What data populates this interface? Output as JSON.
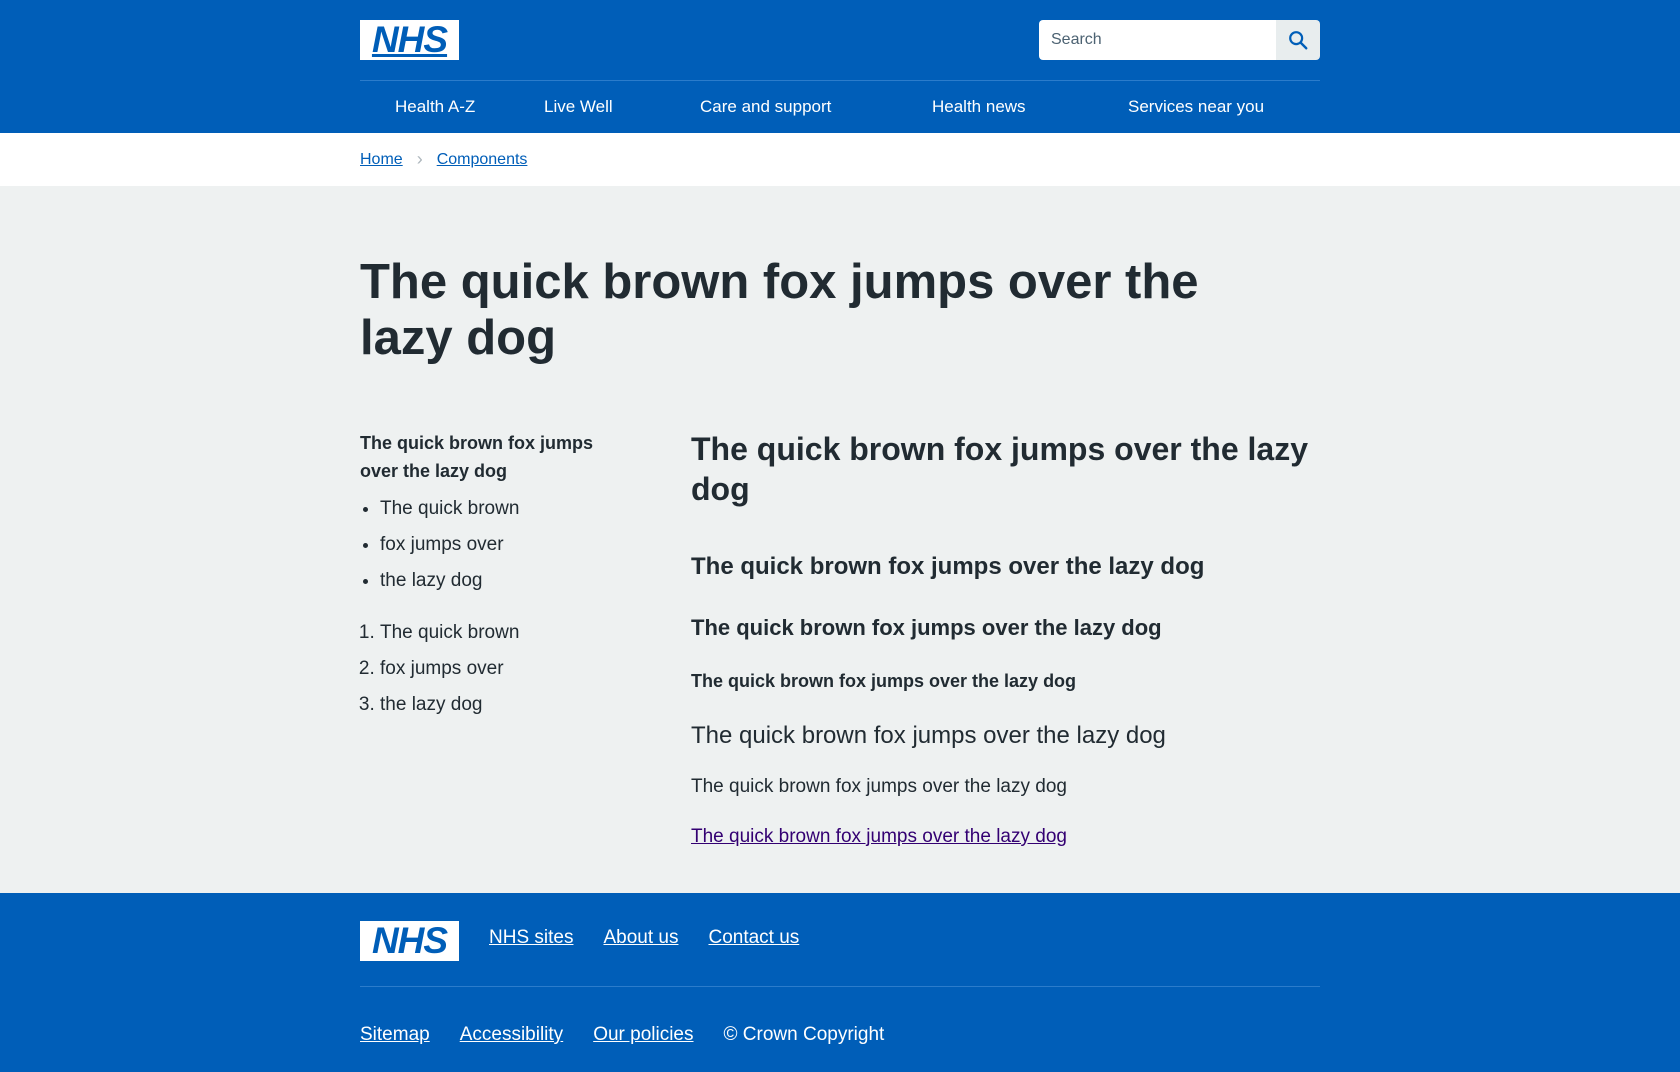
{
  "header": {
    "logo_text": "NHS",
    "search_placeholder": "Search",
    "nav": [
      "Health A-Z",
      "Live Well",
      "Care and support",
      "Health news",
      "Services near you"
    ]
  },
  "breadcrumb": {
    "home": "Home",
    "components": "Components"
  },
  "main": {
    "title": "The quick brown fox jumps over the lazy dog",
    "left_heading": "The quick brown fox jumps over the lazy dog",
    "bullets": [
      "The quick brown",
      "fox jumps over",
      "the lazy dog"
    ],
    "numbered": [
      "The quick brown",
      "fox jumps over",
      "the lazy dog"
    ],
    "right": {
      "h2": "The quick brown fox jumps over the lazy dog",
      "h3": "The quick brown fox jumps over the lazy dog",
      "h4": "The quick brown fox jumps over the lazy dog",
      "h5": "The quick brown fox jumps over the lazy dog",
      "lede": "The quick brown fox jumps over the lazy dog",
      "body": "The quick brown fox jumps over the lazy dog",
      "link": "The quick brown fox jumps over the lazy dog"
    }
  },
  "footer": {
    "logo_text": "NHS",
    "links_primary": [
      "NHS sites",
      "About us",
      "Contact us"
    ],
    "links_secondary": [
      "Sitemap",
      "Accessibility",
      "Our policies"
    ],
    "copyright": "© Crown Copyright"
  },
  "colors": {
    "nhs_blue": "#005eb8",
    "text": "#212b32",
    "page_bg": "#eef1f1",
    "visited_link": "#330072"
  }
}
